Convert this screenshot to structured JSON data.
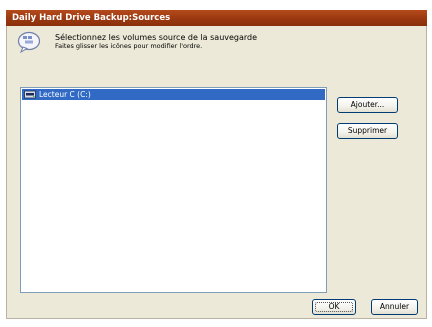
{
  "window": {
    "title": "Daily Hard Drive Backup:Sources"
  },
  "header": {
    "icon": "speech-bubble-icon",
    "title": "Sélectionnez les volumes source de la sauvegarde",
    "subtitle": "Faites glisser les icônes pour modifier l'ordre."
  },
  "sources": {
    "items": [
      {
        "label": "Lecteur C (C:)",
        "icon": "hard-drive-icon",
        "selected": true
      }
    ]
  },
  "buttons": {
    "add": "Ajouter...",
    "remove": "Supprimer",
    "ok": "OK",
    "cancel": "Annuler"
  },
  "colors": {
    "title_bar": "#9a3810",
    "selection": "#316ac5",
    "dialog_bg": "#ece9d8"
  }
}
